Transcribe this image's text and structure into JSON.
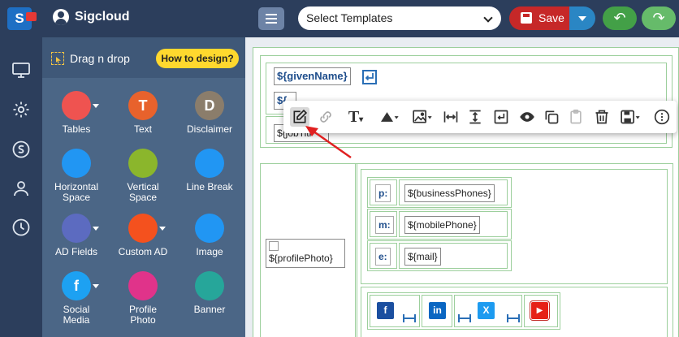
{
  "app": {
    "name": "Sigcloud"
  },
  "rail": {
    "icons": [
      "app-logo",
      "monitor-icon",
      "settings-icon",
      "signature-icon",
      "user-icon",
      "history-icon"
    ]
  },
  "sidebar": {
    "dnd_title": "Drag n drop",
    "how_to_label": "How to design?",
    "tools": [
      {
        "label": "Tables",
        "line2": "",
        "glyph": "",
        "color": "#ef5350",
        "caret": true
      },
      {
        "label": "Text",
        "line2": "",
        "glyph": "T",
        "color": "#e8622c",
        "caret": false
      },
      {
        "label": "Disclaimer",
        "line2": "",
        "glyph": "D",
        "color": "#8b7d6b",
        "caret": false
      },
      {
        "label": "Horizontal",
        "line2": "Space",
        "glyph": "",
        "color": "#2196f3",
        "caret": false
      },
      {
        "label": "Vertical",
        "line2": "Space",
        "glyph": "",
        "color": "#8bb62c",
        "caret": false
      },
      {
        "label": "Line Break",
        "line2": "",
        "glyph": "",
        "color": "#2196f3",
        "caret": false
      },
      {
        "label": "AD Fields",
        "line2": "",
        "glyph": "",
        "color": "#5c6bc0",
        "caret": true
      },
      {
        "label": "Custom AD",
        "line2": "",
        "glyph": "",
        "color": "#f4511e",
        "caret": true
      },
      {
        "label": "Image",
        "line2": "",
        "glyph": "",
        "color": "#2196f3",
        "caret": false
      },
      {
        "label": "Social",
        "line2": "Media",
        "glyph": "f",
        "color": "#1da1f2",
        "caret": true
      },
      {
        "label": "Profile",
        "line2": "Photo",
        "glyph": "",
        "color": "#e0338a",
        "caret": false
      },
      {
        "label": "Banner",
        "line2": "",
        "glyph": "",
        "color": "#26a69a",
        "caret": false
      }
    ]
  },
  "topbar": {
    "template_select": "Select Templates",
    "save_label": "Save"
  },
  "canvas": {
    "given_name": "${givenName}",
    "partial_field": "${",
    "job_title": "${jobTitl",
    "profile_photo": "${profilePhoto}",
    "phones": [
      {
        "label": "p:",
        "value": "${businessPhones}"
      },
      {
        "label": "m:",
        "value": "${mobilePhone}"
      },
      {
        "label": "e:",
        "value": "${mail}"
      }
    ],
    "social": [
      {
        "glyph": "f",
        "color": "#1b4fa0"
      },
      {
        "glyph": "in",
        "color": "#0a66c2"
      },
      {
        "glyph": "X",
        "color": "#1d9bf0"
      },
      {
        "glyph": "▶",
        "color": "#e62117"
      }
    ]
  },
  "colors": {
    "accent_red": "#c62828",
    "accent_green": "#43a047",
    "panel": "#4b6686",
    "dark": "#2c3e5c"
  }
}
